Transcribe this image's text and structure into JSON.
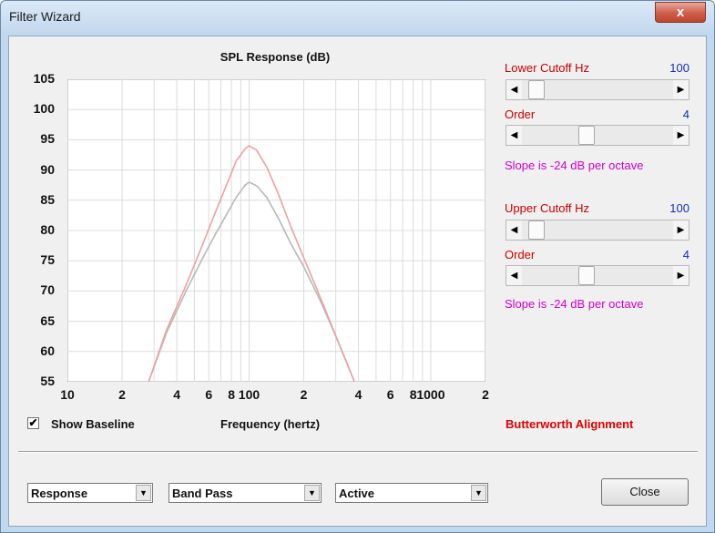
{
  "window": {
    "title": "Filter Wizard",
    "close_glyph": "x"
  },
  "plot": {
    "title": "SPL Response (dB)",
    "x_label": "Frequency (hertz)",
    "x_ticks": [
      "10",
      "2",
      "4",
      "6",
      "8",
      "100",
      "2",
      "4",
      "6",
      "8",
      "1000",
      "2"
    ],
    "y_ticks": [
      "105",
      "100",
      "95",
      "90",
      "85",
      "80",
      "75",
      "70",
      "65",
      "60",
      "55"
    ]
  },
  "chart_data": {
    "type": "line",
    "title": "SPL Response (dB)",
    "xlabel": "Frequency (hertz)",
    "ylabel": "",
    "x_scale": "log",
    "xlim": [
      10,
      2000
    ],
    "ylim": [
      55,
      105
    ],
    "grid": true,
    "series": [
      {
        "name": "",
        "color": "#f0a0a0",
        "x": [
          28,
          35,
          45,
          55,
          65,
          75,
          85,
          95,
          100,
          110,
          125,
          145,
          170,
          200,
          250,
          300,
          350,
          380
        ],
        "y": [
          55,
          63.4,
          71,
          77.4,
          82.9,
          87.5,
          91.5,
          93.5,
          94,
          93.3,
          90.5,
          86,
          80.6,
          75.5,
          68.5,
          62.6,
          57.7,
          55
        ]
      },
      {
        "name": "",
        "color": "#b8b8b8",
        "x": [
          28,
          35,
          45,
          55,
          65,
          75,
          85,
          95,
          100,
          110,
          125,
          145,
          170,
          200,
          250,
          300,
          350,
          380
        ],
        "y": [
          55,
          63,
          70,
          75.2,
          79.3,
          82.6,
          85.5,
          87.5,
          88,
          87.4,
          85.5,
          82,
          77.8,
          74,
          68,
          62.5,
          57.6,
          55
        ]
      }
    ]
  },
  "controls": {
    "lower_cutoff": {
      "label": "Lower Cutoff  Hz",
      "value": "100",
      "slider": 0.05
    },
    "lower_order": {
      "label": "Order",
      "value": "4",
      "slider": 0.42
    },
    "lower_slope": "Slope is -24 dB per octave",
    "upper_cutoff": {
      "label": "Upper Cutoff  Hz",
      "value": "100",
      "slider": 0.05
    },
    "upper_order": {
      "label": "Order",
      "value": "4",
      "slider": 0.42
    },
    "upper_slope": "Slope is -24 dB per octave"
  },
  "baseline": {
    "checked": true,
    "check_glyph": "✔",
    "label": "Show Baseline"
  },
  "alignment": "Butterworth Alignment",
  "combos": {
    "response": "Response",
    "filter_type": "Band Pass",
    "mode": "Active"
  },
  "buttons": {
    "close": "Close"
  },
  "colors": {
    "label_red": "#cc0000",
    "value_blue": "#1030c0",
    "slope_magenta": "#d000d0",
    "alignment_red": "#e00000"
  }
}
